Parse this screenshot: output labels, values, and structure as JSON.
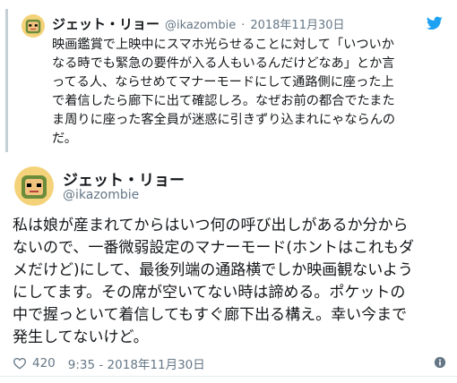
{
  "quoted_tweet": {
    "display_name": "ジェット・リョー",
    "handle": "@ikazombie",
    "separator": "·",
    "date": "2018年11月30日",
    "text": "映画鑑賞で上映中にスマホ光らせることに対して「いついか\nなる時でも緊急の要件が入る人もいるんだけどなあ」とか言\nってる人、ならせめてマナーモードにして通路側に座った上\nで着信したら廊下に出て確認しろ。なぜお前の都合でたまた\nま周りに座った客全員が迷惑に引きずり込まれにゃならんの\nだ。",
    "bird_icon": "twitter-bird-icon"
  },
  "tweet": {
    "display_name": "ジェット・リョー",
    "handle": "@ikazombie",
    "text": "私は娘が産まれてからはいつ何の呼び出しがあるか分から\nないので、一番微弱設定のマナーモード(ホントはこれもダ\nメだけど)にして、最後列端の通路横でしか映画観ないよう\nにしてます。その席が空いてない時は諦める。ポケットの\n中で握っといて着信してもすぐ廊下出る構え。幸い今まで\n発生してないけど。",
    "likes": "420",
    "timestamp": "9:35 - 2018年11月30日"
  },
  "colors": {
    "text": "#14171a",
    "muted": "#657786",
    "twitter_blue": "#1da1f2",
    "quote_bar": "#c4cfd6"
  }
}
